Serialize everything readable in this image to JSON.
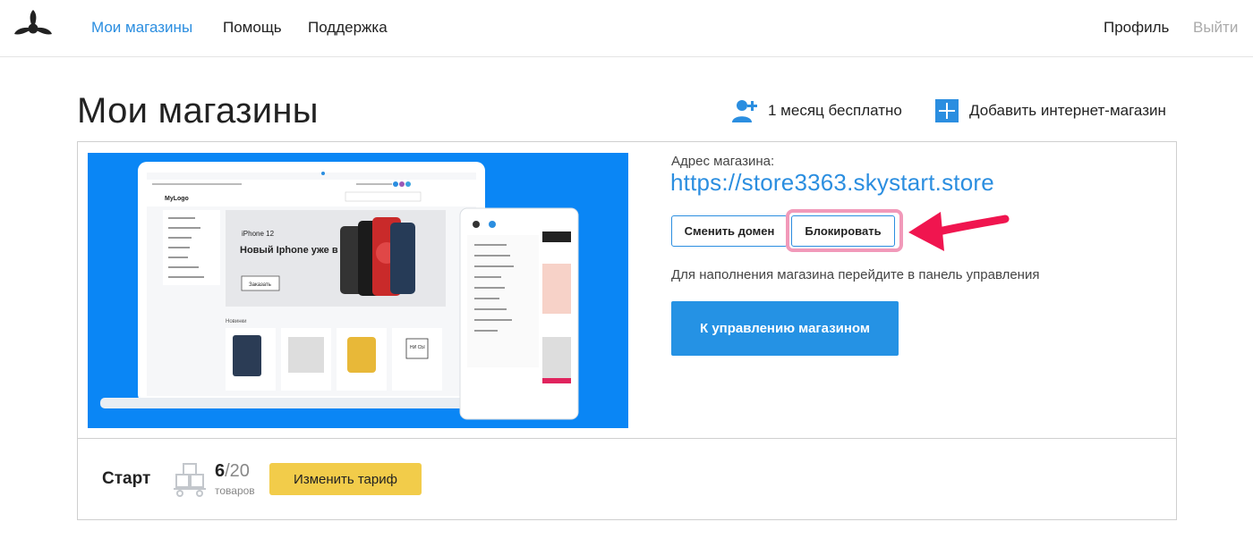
{
  "nav": {
    "items": [
      "Мои магазины",
      "Помощь",
      "Поддержка"
    ],
    "profile": "Профиль",
    "logout": "Выйти"
  },
  "page": {
    "title": "Мои магазины",
    "free_month": "1 месяц бесплатно",
    "add_store": "Добавить интернет-магазин"
  },
  "store": {
    "address_label": "Адрес магазина:",
    "address": "https://store3363.skystart.store",
    "change_domain": "Сменить домен",
    "block": "Блокировать",
    "hint": "Для наполнения магазина перейдите в панель управления",
    "manage": "К управлению магазином"
  },
  "preview": {
    "brand": "MyLogo",
    "promo_model": "iPhone 12",
    "promo_title": "Новый Iphone уже в наличии!",
    "promo_button": "Заказать",
    "section_title": "Новинки",
    "sign_text": "НИ СЫ"
  },
  "plan": {
    "name": "Старт",
    "used": "6",
    "total": "/20",
    "unit": "товаров",
    "change": "Изменить тариф"
  },
  "colors": {
    "accent": "#2b8ee0",
    "primary_button": "#2592e4",
    "yellow_button": "#f2cc4a",
    "annotation": "#f0154f",
    "preview_bg": "#0a86f5"
  }
}
